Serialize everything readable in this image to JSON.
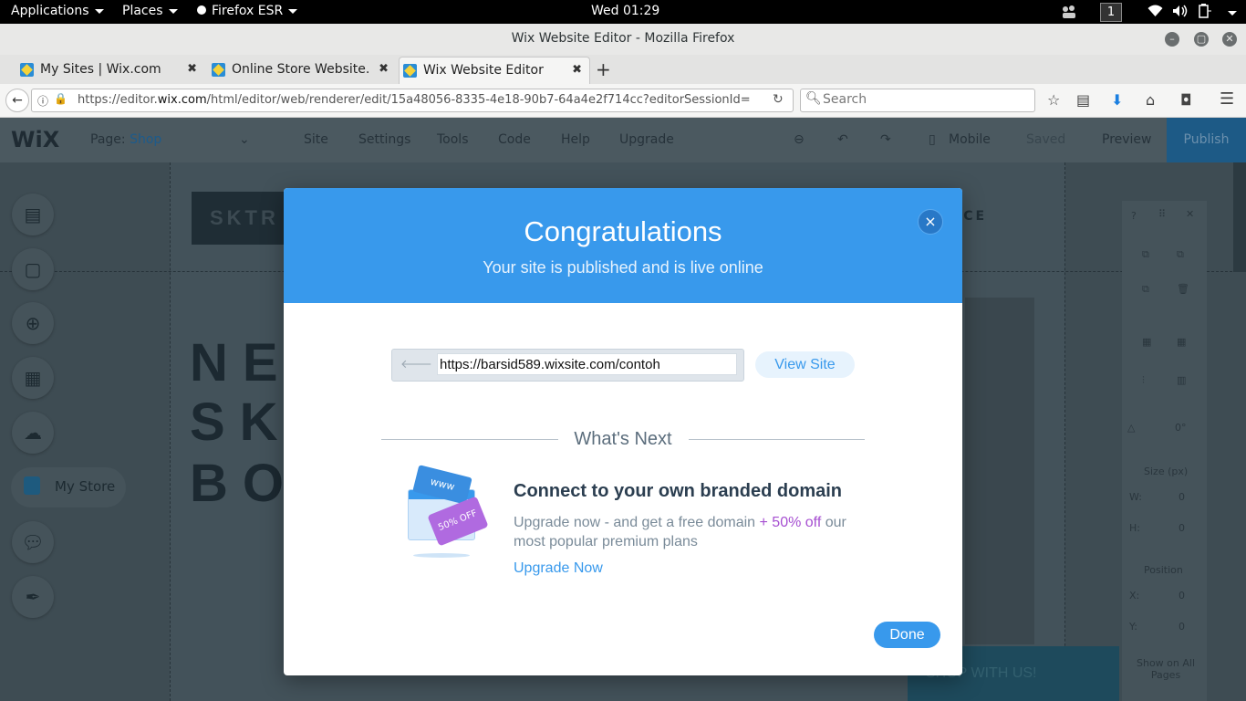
{
  "system_bar": {
    "applications": "Applications",
    "places": "Places",
    "browser_menu": "Firefox ESR",
    "clock": "Wed 01:29",
    "workspace": "1"
  },
  "window": {
    "title": "Wix Website Editor - Mozilla Firefox"
  },
  "tabs": [
    {
      "label": "My Sites | Wix.com",
      "active": false
    },
    {
      "label": "Online Store Website...",
      "active": false
    },
    {
      "label": "Wix Website Editor",
      "active": true
    }
  ],
  "navbar": {
    "url_prefix": "https://editor.",
    "url_domain": "wix.com",
    "url_rest": "/html/editor/web/renderer/edit/15a48056-8335-4e18-90b7-64a4e2f714cc?editorSessionId=",
    "search_placeholder": "Search"
  },
  "editor_toolbar": {
    "logo": "WiX",
    "page_label": "Page:",
    "page_value": "Shop",
    "menu": [
      "Site",
      "Settings",
      "Tools",
      "Code",
      "Help",
      "Upgrade"
    ],
    "mobile": "Mobile",
    "saved": "Saved",
    "preview": "Preview",
    "publish": "Publish"
  },
  "canvas": {
    "logo_text": "SKTR",
    "nav_text": "ICE",
    "hero_lines": [
      "NE",
      "SK",
      "BO"
    ],
    "store_label": "My Store",
    "footer_button": "SHOP WITH US!",
    "panel": {
      "size_label": "Size (px)",
      "w": "W:",
      "h": "H:",
      "position_label": "Position",
      "x": "X:",
      "y": "Y:",
      "zero": "0",
      "show_all": "Show on All Pages",
      "angle": "0°"
    }
  },
  "modal": {
    "title": "Congratulations",
    "subtitle": "Your site is published and is live online",
    "site_url": "https://barsid589.wixsite.com/contoh",
    "view_site": "View Site",
    "whats_next": "What's Next",
    "promo_title": "Connect to your own branded domain",
    "promo_body_1": "Upgrade now - and get a free domain ",
    "promo_highlight": "+ 50% off",
    "promo_body_2": " our most popular premium plans",
    "upgrade_now": "Upgrade Now",
    "done": "Done",
    "illustration_www": "www",
    "illustration_tag": "50% OFF"
  },
  "colors": {
    "wix_blue": "#3899ec",
    "promo_purple": "#a64fd1",
    "overlay_dark": "#3e4c53"
  }
}
